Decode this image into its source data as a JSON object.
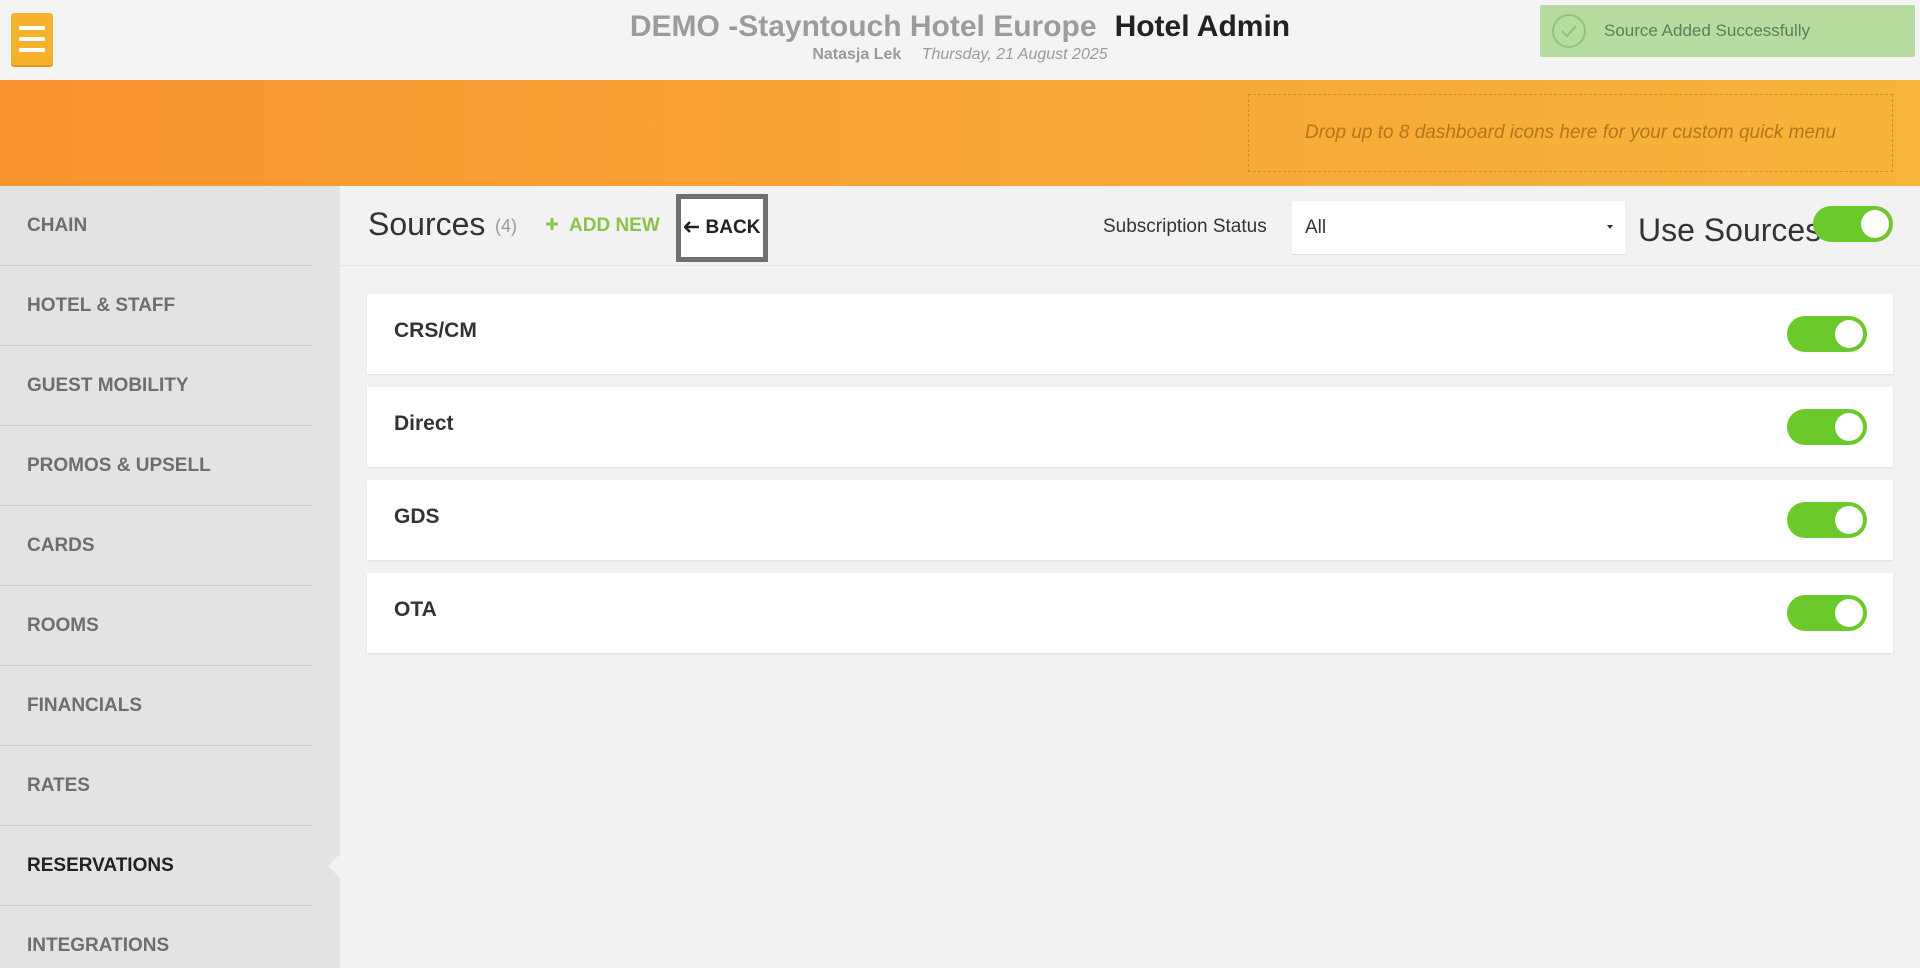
{
  "header": {
    "hotel_name": "DEMO -Stayntouch Hotel Europe",
    "app_title": "Hotel Admin",
    "user_name": "Natasja Lek",
    "date": "Thursday, 21 August 2025"
  },
  "toast": {
    "message": "Source Added Successfully"
  },
  "banner": {
    "dropzone_text": "Drop up to 8 dashboard icons here for your custom quick menu"
  },
  "sidebar": {
    "items": [
      {
        "label": "CHAIN"
      },
      {
        "label": "HOTEL & STAFF"
      },
      {
        "label": "GUEST MOBILITY"
      },
      {
        "label": "PROMOS & UPSELL"
      },
      {
        "label": "CARDS"
      },
      {
        "label": "ROOMS"
      },
      {
        "label": "FINANCIALS"
      },
      {
        "label": "RATES"
      },
      {
        "label": "RESERVATIONS"
      },
      {
        "label": "INTEGRATIONS"
      }
    ],
    "active": "RESERVATIONS"
  },
  "toolbar": {
    "title": "Sources",
    "count": "(4)",
    "add_new_label": "ADD NEW",
    "back_label": "BACK",
    "subscription_status_label": "Subscription Status",
    "subscription_status_value": "All",
    "use_sources_label": "Use Sources",
    "use_sources_enabled": true
  },
  "sources": [
    {
      "name": "CRS/CM",
      "enabled": true
    },
    {
      "name": "Direct",
      "enabled": true
    },
    {
      "name": "GDS",
      "enabled": true
    },
    {
      "name": "OTA",
      "enabled": true
    }
  ],
  "colors": {
    "accent_orange": "#f6b22d",
    "toggle_green": "#6cc92b",
    "add_new_green": "#8bc34a",
    "toast_green": "#b6dca0"
  }
}
